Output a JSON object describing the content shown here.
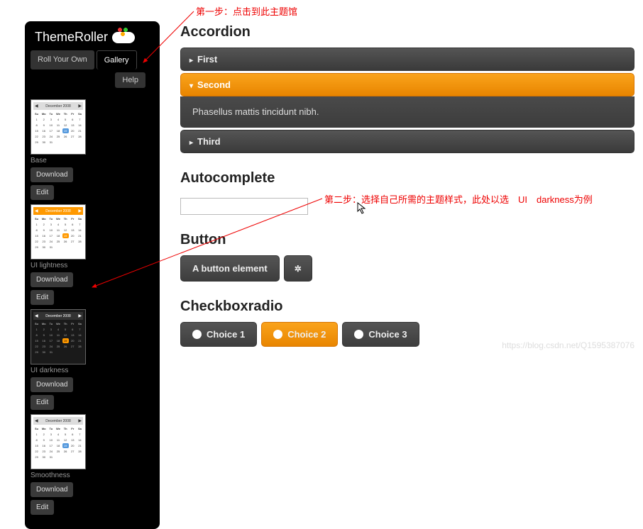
{
  "annotations": {
    "step1": "第一步：点击到此主题馆",
    "step2": "第二步：选择自己所需的主题样式，此处以选　UI　darkness为例"
  },
  "sidebar": {
    "logo": "ThemeRoller",
    "tabs": {
      "roll": "Roll Your Own",
      "gallery": "Gallery"
    },
    "help": "Help",
    "themes": [
      {
        "name": "Base",
        "download": "Download",
        "edit": "Edit",
        "variant": "light",
        "month": "December 2008"
      },
      {
        "name": "UI lightness",
        "download": "Download",
        "edit": "Edit",
        "variant": "orange",
        "month": "December 2008"
      },
      {
        "name": "UI darkness",
        "download": "Download",
        "edit": "Edit",
        "variant": "dark",
        "month": "December 2008"
      },
      {
        "name": "Smoothness",
        "download": "Download",
        "edit": "Edit",
        "variant": "light",
        "month": "December 2008"
      }
    ]
  },
  "accordion": {
    "title": "Accordion",
    "items": [
      {
        "label": "First",
        "active": false
      },
      {
        "label": "Second",
        "active": true,
        "body": "Phasellus mattis tincidunt nibh."
      },
      {
        "label": "Third",
        "active": false
      }
    ]
  },
  "autocomplete": {
    "title": "Autocomplete",
    "value": ""
  },
  "button": {
    "title": "Button",
    "label": "A button element",
    "icon_label": "✲"
  },
  "checkboxradio": {
    "title": "Checkboxradio",
    "choices": [
      {
        "label": "Choice 1",
        "active": false
      },
      {
        "label": "Choice 2",
        "active": true
      },
      {
        "label": "Choice 3",
        "active": false
      }
    ]
  },
  "watermark": "https://blog.csdn.net/Q1595387076",
  "calendar_days": [
    "Su",
    "Mo",
    "Tu",
    "We",
    "Th",
    "Fr",
    "Sa"
  ]
}
